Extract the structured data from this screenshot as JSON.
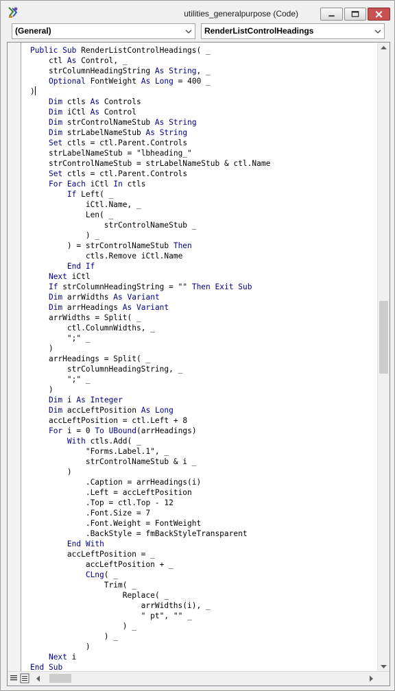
{
  "window": {
    "title": "utilities_generalpurpose (Code)",
    "buttons": [
      "minimize",
      "maximize",
      "close"
    ],
    "icons": [
      "vba-project-icon",
      "minimize-icon",
      "maximize-icon",
      "close-icon"
    ]
  },
  "combos": {
    "object": "(General)",
    "procedure": "RenderListControlHeadings"
  },
  "colors": {
    "keyword": "#00008b",
    "code_text": "#000000",
    "close_button": "#c75050",
    "editor_background": "#ffffff"
  },
  "code": [
    "Public Sub RenderListControlHeadings( _",
    "    ctl As Control, _",
    "    strColumnHeadingString As String, _",
    "    Optional FontWeight As Long = 400 _",
    ")",
    "    Dim ctls As Controls",
    "    Dim iCtl As Control",
    "    Dim strControlNameStub As String",
    "    Dim strLabelNameStub As String",
    "    Set ctls = ctl.Parent.Controls",
    "    strLabelNameStub = \"lbheading_\"",
    "    strControlNameStub = strLabelNameStub & ctl.Name",
    "    Set ctls = ctl.Parent.Controls",
    "    For Each iCtl In ctls",
    "        If Left( _",
    "            iCtl.Name, _",
    "            Len( _",
    "                strControlNameStub _",
    "            ) _",
    "        ) = strControlNameStub Then",
    "            ctls.Remove iCtl.Name",
    "        End If",
    "    Next iCtl",
    "    If strColumnHeadingString = \"\" Then Exit Sub",
    "    Dim arrWidths As Variant",
    "    Dim arrHeadings As Variant",
    "    arrWidths = Split( _",
    "        ctl.ColumnWidths, _",
    "        \";\" _",
    "    )",
    "    arrHeadings = Split( _",
    "        strColumnHeadingString, _",
    "        \";\" _",
    "    )",
    "    Dim i As Integer",
    "    Dim accLeftPosition As Long",
    "    accLeftPosition = ctl.Left + 8",
    "    For i = 0 To UBound(arrHeadings)",
    "        With ctls.Add( _",
    "            \"Forms.Label.1\", _",
    "            strControlNameStub & i _",
    "        )",
    "            .Caption = arrHeadings(i)",
    "            .Left = accLeftPosition",
    "            .Top = ctl.Top - 12",
    "            .Font.Size = 7",
    "            .Font.Weight = FontWeight",
    "            .BackStyle = fmBackStyleTransparent",
    "        End With",
    "        accLeftPosition = _",
    "            accLeftPosition + _",
    "            CLng( _",
    "                Trim( _",
    "                    Replace( _",
    "                        arrWidths(i), _",
    "                        \" pt\", \"\" _",
    "                    ) _",
    "                ) _",
    "            )",
    "    Next i",
    "End Sub"
  ],
  "cursor_line": 4,
  "vertical_scroll": {
    "arrow_icons": [
      "scroll-up-icon",
      "scroll-down-icon"
    ]
  },
  "footer": {
    "icons": [
      "procedure-view-icon",
      "full-module-view-icon",
      "scroll-left-icon",
      "scroll-right-icon"
    ]
  }
}
